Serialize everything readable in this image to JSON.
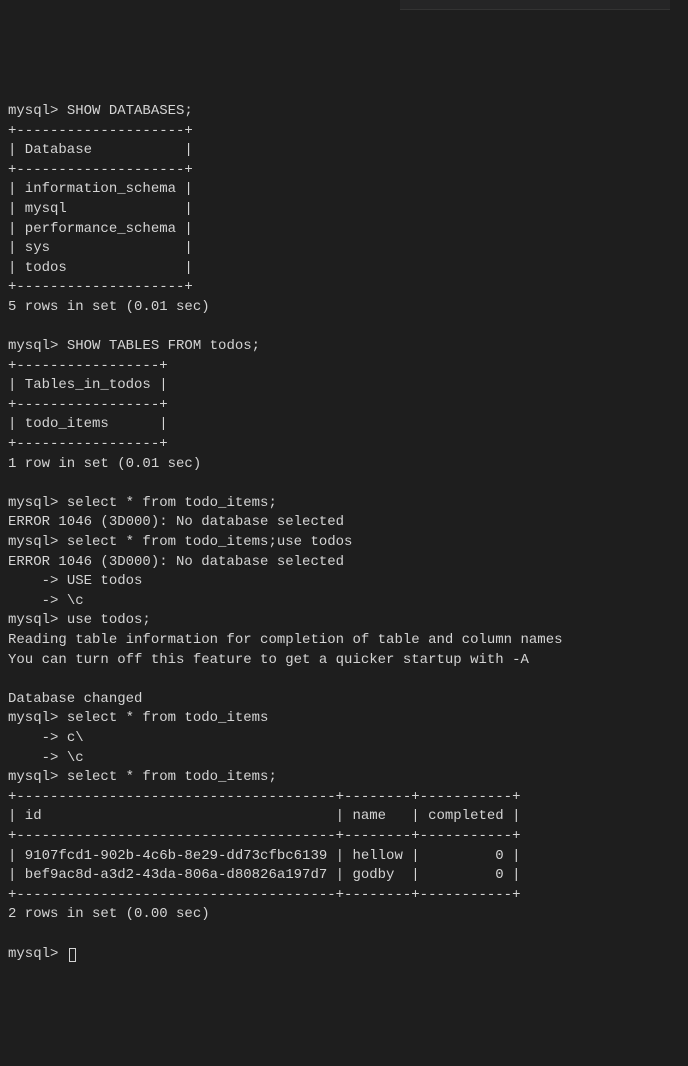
{
  "prompt": "mysql> ",
  "cont_prompt": "    -> ",
  "cmd1": "SHOW DATABASES;",
  "db_border_top": "+--------------------+",
  "db_header": "| Database           |",
  "databases": [
    "| information_schema |",
    "| mysql              |",
    "| performance_schema |",
    "| sys                |",
    "| todos              |"
  ],
  "db_summary": "5 rows in set (0.01 sec)",
  "cmd2": "SHOW TABLES FROM todos;",
  "tbl_border": "+-----------------+",
  "tbl_header": "| Tables_in_todos |",
  "tbl_row": "| todo_items      |",
  "tbl_summary": "1 row in set (0.01 sec)",
  "cmd3": "select * from todo_items;",
  "err1": "ERROR 1046 (3D000): No database selected",
  "cmd4": "select * from todo_items;use todos",
  "err2": "ERROR 1046 (3D000): No database selected",
  "cont1": "USE todos",
  "cont2": "\\c",
  "cmd5": "use todos;",
  "reading1": "Reading table information for completion of table and column names",
  "reading2": "You can turn off this feature to get a quicker startup with -A",
  "db_changed": "Database changed",
  "cmd6": "select * from todo_items",
  "cont3": "c\\",
  "cont4": "\\c",
  "cmd7": "select * from todo_items;",
  "items_border": "+--------------------------------------+--------+-----------+",
  "items_header": "| id                                   | name   | completed |",
  "items_rows": [
    "| 9107fcd1-902b-4c6b-8e29-dd73cfbc6139 | hellow |         0 |",
    "| bef9ac8d-a3d2-43da-806a-d80826a197d7 | godby  |         0 |"
  ],
  "items_summary": "2 rows in set (0.00 sec)",
  "chart_data": {
    "type": "table",
    "tables": [
      {
        "title": "Databases",
        "columns": [
          "Database"
        ],
        "rows": [
          [
            "information_schema"
          ],
          [
            "mysql"
          ],
          [
            "performance_schema"
          ],
          [
            "sys"
          ],
          [
            "todos"
          ]
        ]
      },
      {
        "title": "Tables_in_todos",
        "columns": [
          "Tables_in_todos"
        ],
        "rows": [
          [
            "todo_items"
          ]
        ]
      },
      {
        "title": "todo_items",
        "columns": [
          "id",
          "name",
          "completed"
        ],
        "rows": [
          [
            "9107fcd1-902b-4c6b-8e29-dd73cfbc6139",
            "hellow",
            0
          ],
          [
            "bef9ac8d-a3d2-43da-806a-d80826a197d7",
            "godby",
            0
          ]
        ]
      }
    ]
  }
}
